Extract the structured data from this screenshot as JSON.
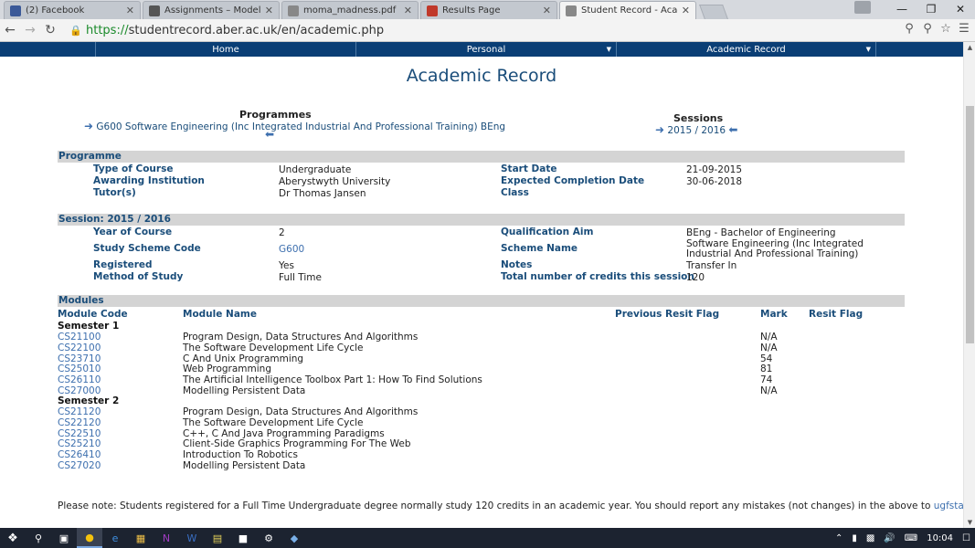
{
  "browser": {
    "tabs": [
      {
        "title": "(2) Facebook",
        "favicon": "facebook-icon",
        "color": "#3b5998",
        "active": false
      },
      {
        "title": "Assignments – Modelling",
        "favicon": "document-icon",
        "color": "#555555",
        "active": false
      },
      {
        "title": "moma_madness.pdf",
        "favicon": "page-icon",
        "color": "#888888",
        "active": false
      },
      {
        "title": "Results Page",
        "favicon": "results-icon",
        "color": "#c0392b",
        "active": false
      },
      {
        "title": "Student Record - Academ",
        "favicon": "page-icon",
        "color": "#888888",
        "active": true
      }
    ],
    "url_scheme": "https://",
    "url_rest": "studentrecord.aber.ac.uk/en/academic.php"
  },
  "site_nav": {
    "items": [
      {
        "label": "Home",
        "dropdown": false
      },
      {
        "label": "Personal",
        "dropdown": true
      },
      {
        "label": "Academic Record",
        "dropdown": true
      }
    ],
    "color": "#0a3e75"
  },
  "page": {
    "title": "Academic Record",
    "programmes_heading": "Programmes",
    "programme_link": "G600 Software Engineering (Inc Integrated Industrial And Professional Training) BEng",
    "sessions_heading": "Sessions",
    "session_link": "2015 / 2016"
  },
  "programme": {
    "heading": "Programme",
    "fields": [
      {
        "label": "Type of Course",
        "value": "Undergraduate"
      },
      {
        "label": "Awarding Institution",
        "value": "Aberystwyth University"
      },
      {
        "label": "Tutor(s)",
        "value": "Dr Thomas Jansen"
      }
    ],
    "fields_right": [
      {
        "label": "Start Date",
        "value": "21-09-2015"
      },
      {
        "label": "Expected Completion Date",
        "value": "30-06-2018"
      },
      {
        "label": "Class",
        "value": ""
      }
    ]
  },
  "session": {
    "heading": "Session: 2015 / 2016",
    "fields": [
      {
        "label": "Year of Course",
        "value": "2"
      },
      {
        "label": "Study Scheme Code",
        "value": "G600"
      },
      {
        "label": "Registered",
        "value": "Yes"
      },
      {
        "label": "Method of Study",
        "value": "Full Time"
      }
    ],
    "fields_right": [
      {
        "label": "Qualification Aim",
        "value": "BEng - Bachelor of Engineering"
      },
      {
        "label": "Scheme Name",
        "value": "Software Engineering (Inc Integrated",
        "value2": "Industrial And Professional Training)"
      },
      {
        "label": "Notes",
        "value": "Transfer In"
      },
      {
        "label": "Total number of credits this session",
        "value": "120"
      }
    ]
  },
  "modules": {
    "heading": "Modules",
    "columns": {
      "code": "Module Code",
      "name": "Module Name",
      "prev_resit": "Previous Resit Flag",
      "mark": "Mark",
      "resit": "Resit Flag"
    },
    "semester1": {
      "label": "Semester 1",
      "rows": [
        {
          "code": "CS21100",
          "name": "Program Design, Data Structures And Algorithms",
          "mark": "N/A"
        },
        {
          "code": "CS22100",
          "name": "The Software Development Life Cycle",
          "mark": "N/A"
        },
        {
          "code": "CS23710",
          "name": "C And Unix Programming",
          "mark": "54"
        },
        {
          "code": "CS25010",
          "name": "Web Programming",
          "mark": "81"
        },
        {
          "code": "CS26110",
          "name": "The Artificial Intelligence Toolbox Part 1: How To Find Solutions",
          "mark": "74"
        },
        {
          "code": "CS27000",
          "name": "Modelling Persistent Data",
          "mark": "N/A"
        }
      ]
    },
    "semester2": {
      "label": "Semester 2",
      "rows": [
        {
          "code": "CS21120",
          "name": "Program Design, Data Structures And Algorithms",
          "mark": ""
        },
        {
          "code": "CS22120",
          "name": "The Software Development Life Cycle",
          "mark": ""
        },
        {
          "code": "CS22510",
          "name": "C++, C And Java Programming Paradigms",
          "mark": ""
        },
        {
          "code": "CS25210",
          "name": "Client-Side Graphics Programming For The Web",
          "mark": ""
        },
        {
          "code": "CS26410",
          "name": "Introduction To Robotics",
          "mark": ""
        },
        {
          "code": "CS27020",
          "name": "Modelling Persistent Data",
          "mark": ""
        }
      ]
    }
  },
  "footer": {
    "note": "Please note: Students registered for a Full Time Undergraduate degree normally study 120 credits in an academic year. You should report any mistakes (not changes) in the above to",
    "email": "ugfstaff@aber.ac.uk"
  },
  "taskbar": {
    "time": "10:04"
  }
}
